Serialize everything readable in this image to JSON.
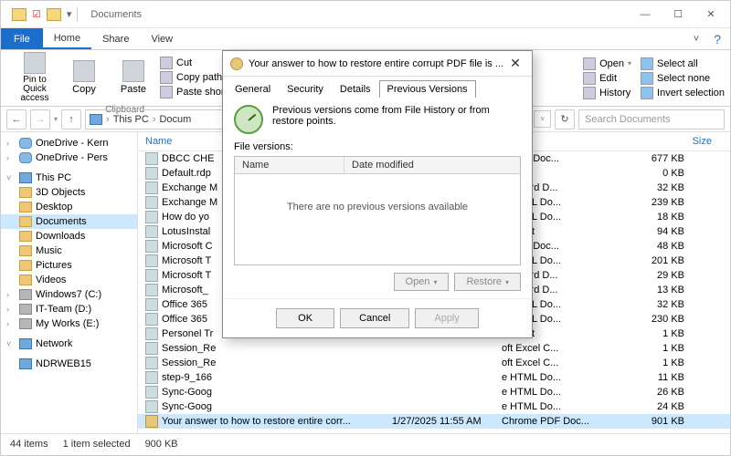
{
  "titlebar": {
    "title": "Documents"
  },
  "win": {
    "expand_label": "˅"
  },
  "ribbon": {
    "file": "File",
    "tabs": [
      "Home",
      "Share",
      "View"
    ],
    "pin": "Pin to Quick access",
    "copy": "Copy",
    "paste": "Paste",
    "cut": "Cut",
    "copypath": "Copy path",
    "pasteshortcut": "Paste shortcu",
    "clipboard_label": "Clipboard",
    "open": "Open",
    "edit": "Edit",
    "history": "History",
    "selectall": "Select all",
    "selectnone": "Select none",
    "invertsel": "Invert selection"
  },
  "addr": {
    "thispc": "This PC",
    "docs": "Docum",
    "refresh": "↻",
    "search_placeholder": "Search Documents"
  },
  "nav": {
    "items": [
      {
        "label": "OneDrive - Kern",
        "cls": "cloud",
        "exp": "›"
      },
      {
        "label": "OneDrive - Pers",
        "cls": "cloud",
        "exp": "›"
      },
      {
        "label": "This PC",
        "cls": "pc",
        "exp": "˅"
      },
      {
        "label": "3D Objects",
        "cls": "",
        "exp": ""
      },
      {
        "label": "Desktop",
        "cls": "",
        "exp": ""
      },
      {
        "label": "Documents",
        "cls": "",
        "exp": "",
        "sel": true
      },
      {
        "label": "Downloads",
        "cls": "",
        "exp": ""
      },
      {
        "label": "Music",
        "cls": "",
        "exp": ""
      },
      {
        "label": "Pictures",
        "cls": "",
        "exp": ""
      },
      {
        "label": "Videos",
        "cls": "",
        "exp": ""
      },
      {
        "label": "Windows7 (C:)",
        "cls": "drive",
        "exp": "›"
      },
      {
        "label": "IT-Team (D:)",
        "cls": "drive",
        "exp": "›"
      },
      {
        "label": "My Works (E:)",
        "cls": "drive",
        "exp": "›"
      },
      {
        "label": "Network",
        "cls": "net",
        "exp": "˅"
      },
      {
        "label": "NDRWEB15",
        "cls": "pc",
        "exp": ""
      }
    ]
  },
  "files": {
    "head_name": "Name",
    "head_type": "",
    "head_size": "Size",
    "rows": [
      {
        "name": "DBCC CHE",
        "type": "e PDF Doc...",
        "size": "677 KB"
      },
      {
        "name": "Default.rdp",
        "type": "ection",
        "size": "0 KB"
      },
      {
        "name": "Exchange M",
        "type": "oft Word D...",
        "size": "32 KB"
      },
      {
        "name": "Exchange M",
        "type": "e HTML Do...",
        "size": "239 KB"
      },
      {
        "name": "How do yo",
        "type": "e HTML Do...",
        "size": "18 KB"
      },
      {
        "name": "LotusInstal",
        "type": "cument",
        "size": "94 KB"
      },
      {
        "name": "Microsoft C",
        "type": "e PDF Doc...",
        "size": "48 KB"
      },
      {
        "name": "Microsoft T",
        "type": "e HTML Do...",
        "size": "201 KB"
      },
      {
        "name": "Microsoft T",
        "type": "oft Word D...",
        "size": "29 KB"
      },
      {
        "name": "Microsoft_",
        "type": "oft Word D...",
        "size": "13 KB"
      },
      {
        "name": "Office 365 ",
        "type": "e HTML Do...",
        "size": "32 KB"
      },
      {
        "name": "Office 365 ",
        "type": "e HTML Do...",
        "size": "230 KB"
      },
      {
        "name": "Personel Tr",
        "type": "cument",
        "size": "1 KB"
      },
      {
        "name": "Session_Re",
        "type": "oft Excel C...",
        "size": "1 KB"
      },
      {
        "name": "Session_Re",
        "type": "oft Excel C...",
        "size": "1 KB"
      },
      {
        "name": "step-9_166",
        "type": "e HTML Do...",
        "size": "11 KB"
      },
      {
        "name": "Sync-Goog",
        "type": "e HTML Do...",
        "size": "26 KB"
      },
      {
        "name": "Sync-Goog",
        "type": "e HTML Do...",
        "size": "24 KB"
      }
    ],
    "selected": {
      "name": "Your answer to how to restore entire corr...",
      "date": "1/27/2025 11:55 AM",
      "type": "Chrome PDF Doc...",
      "size": "901 KB"
    }
  },
  "status": {
    "items": "44 items",
    "sel": "1 item selected",
    "size": "900 KB"
  },
  "dialog": {
    "title": "Your answer to how to restore entire corrupt PDF file is ...",
    "tabs": [
      "General",
      "Security",
      "Details",
      "Previous Versions"
    ],
    "hint": "Previous versions come from File History or from restore points.",
    "fv_label": "File versions:",
    "col_name": "Name",
    "col_date": "Date modified",
    "empty": "There are no previous versions available",
    "open": "Open",
    "restore": "Restore",
    "ok": "OK",
    "cancel": "Cancel",
    "apply": "Apply"
  }
}
